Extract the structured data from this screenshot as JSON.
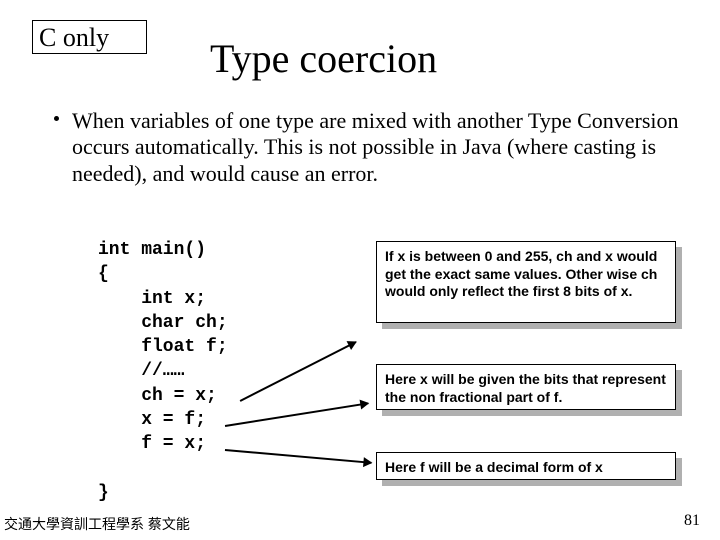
{
  "badge": "C  only",
  "title": "Type coercion",
  "bullet": "When variables of one type are mixed with another Type Conversion occurs automatically. This is not possible in Java (where casting is needed), and would cause an error.",
  "code": "int main()\n{\n    int x;\n    char ch;\n    float f;\n    //……\n    ch = x;\n    x = f;\n    f = x;\n\n}",
  "notes": {
    "n1": "If x is between 0 and 255, ch and x would get the exact same values. Other wise ch would only reflect the first 8 bits of x.",
    "n2": "Here x will be given the bits that represent the non fractional part of f.",
    "n3": "Here f will be a decimal form of x"
  },
  "footer": "交通大學資訓工程學系 蔡文能",
  "pagenum": "81"
}
